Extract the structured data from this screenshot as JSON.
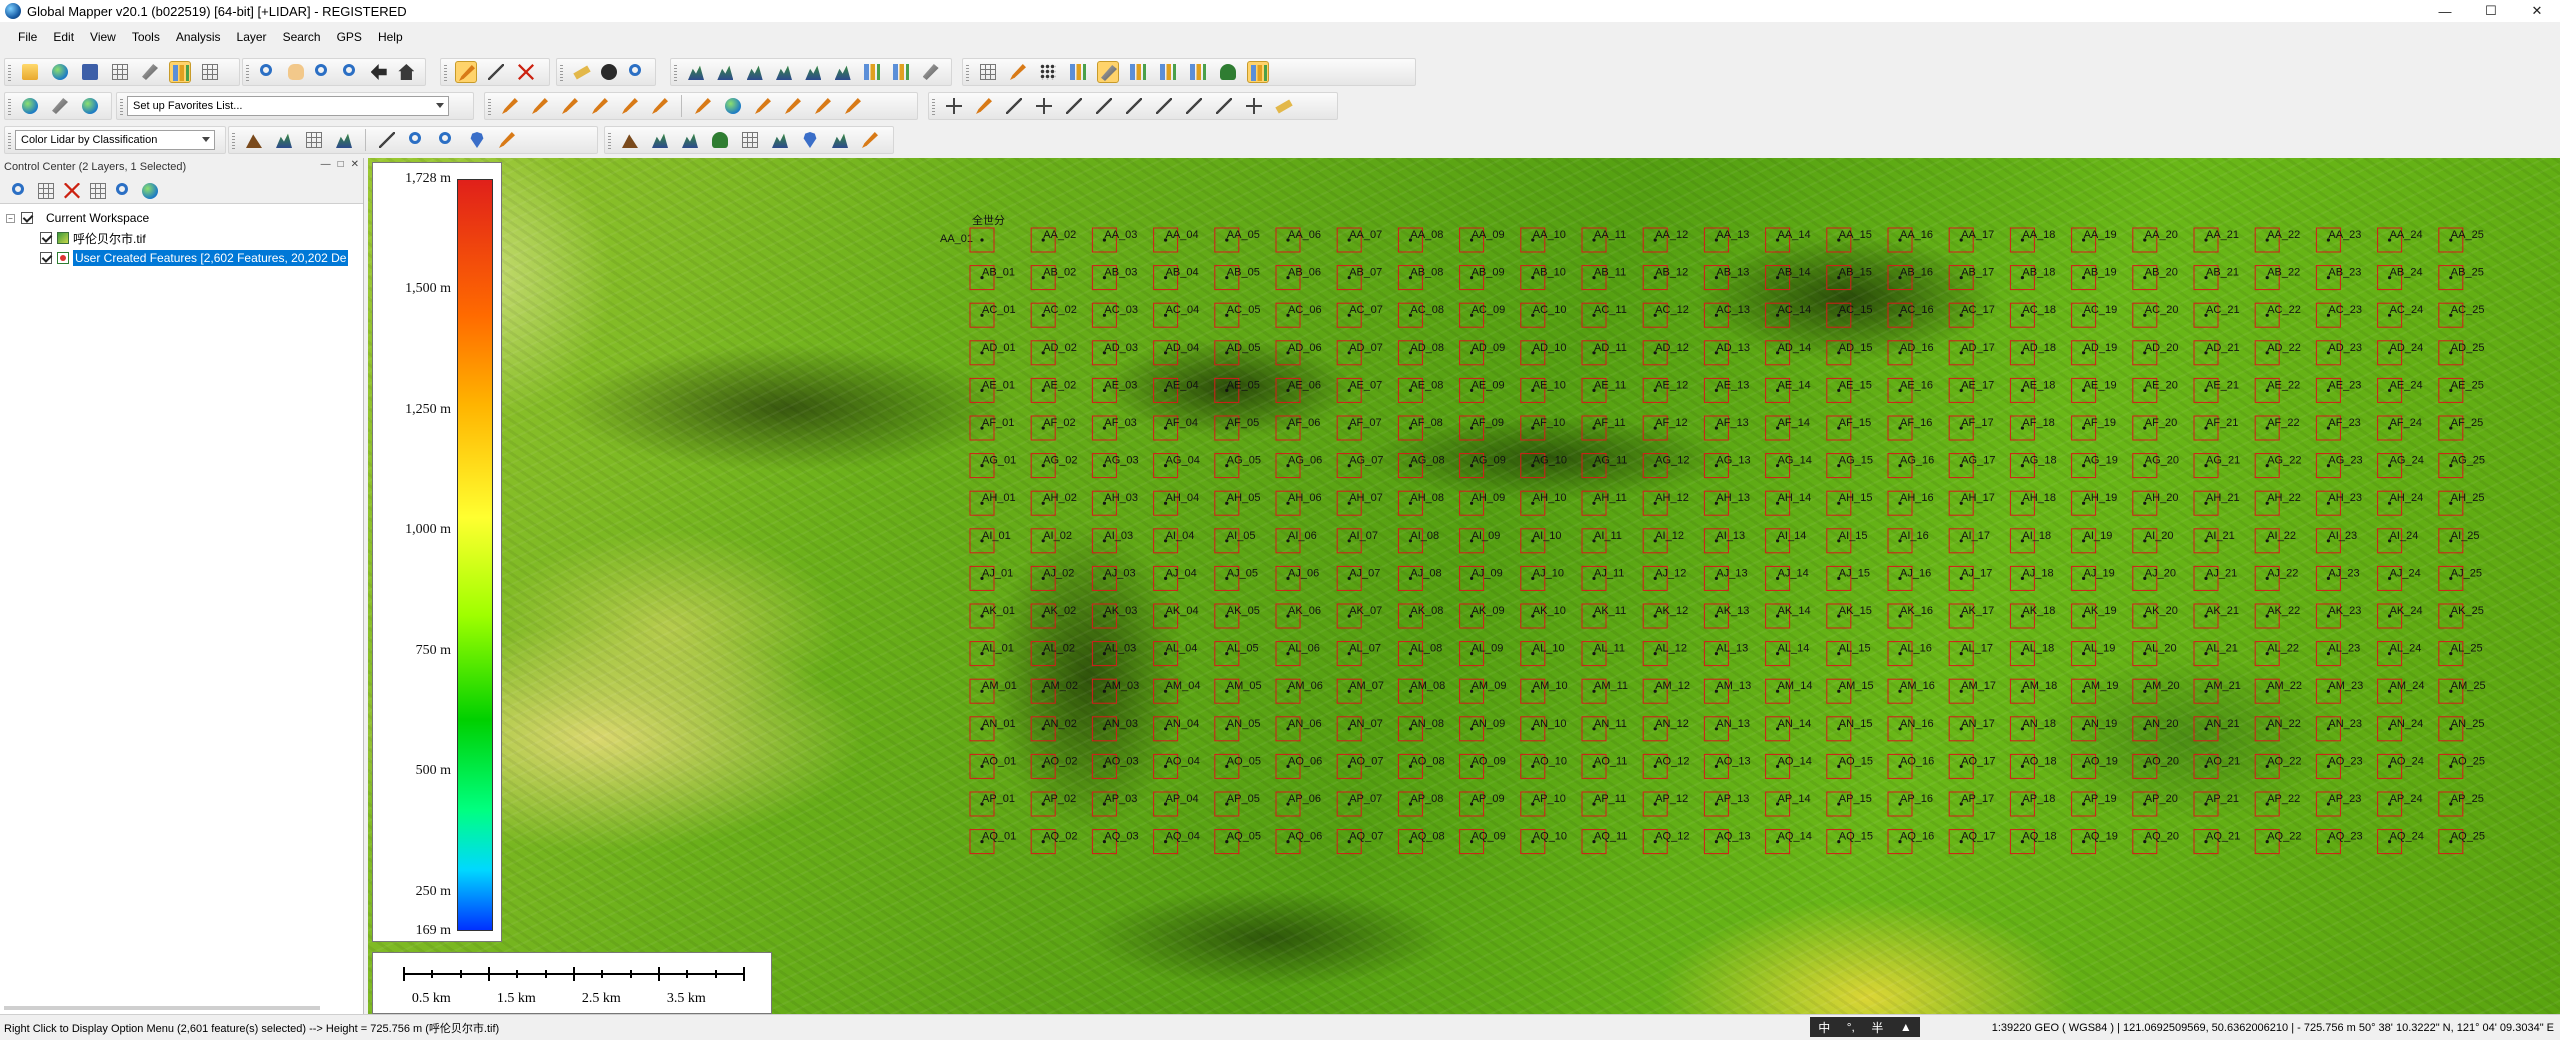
{
  "window": {
    "title": "Global Mapper v20.1 (b022519) [64-bit] [+LIDAR] - REGISTERED",
    "minimize": "—",
    "maximize": "☐",
    "close": "✕"
  },
  "menu": [
    "File",
    "Edit",
    "View",
    "Tools",
    "Analysis",
    "Layer",
    "Search",
    "GPS",
    "Help"
  ],
  "toolbar": {
    "favorites_combo": "Set up Favorites List...",
    "lidar_combo": "Color Lidar by Classification"
  },
  "control_center": {
    "title": "Control Center (2 Layers, 1 Selected)",
    "workspace": "Current Workspace",
    "layers": [
      {
        "name": "呼伦贝尔市.tif",
        "type": "raster",
        "selected": false
      },
      {
        "name": "User Created Features [2,602 Features, 20,202 De",
        "type": "vector",
        "selected": true
      }
    ]
  },
  "legend": {
    "ticks": [
      "1,728 m",
      "1,500 m",
      "1,250 m",
      "1,000 m",
      "750 m",
      "500 m",
      "250 m",
      "169 m"
    ],
    "tick_values": [
      1728,
      1500,
      1250,
      1000,
      750,
      500,
      250,
      169
    ],
    "min": 169,
    "max": 1728
  },
  "scale_bar": {
    "labels": [
      "0.5 km",
      "1.5 km",
      "2.5 km",
      "3.5 km"
    ]
  },
  "grid": {
    "rows": [
      "AA",
      "AB",
      "AC",
      "AD",
      "AE",
      "AF",
      "AG",
      "AH",
      "AI",
      "AJ",
      "AK",
      "AL",
      "AM",
      "AN",
      "AO",
      "AP",
      "AQ"
    ],
    "cols": 25,
    "first_label": "AA_01",
    "header_partial": "全世分"
  },
  "status": {
    "left": "Right Click to Display Option Menu (2,601 feature(s) selected) --> Height = 725.756 m (呼伦贝尔市.tif)",
    "ime": [
      "中",
      "°,",
      "半"
    ],
    "right": "1:39220  GEO ( WGS84 ) | 121.0692509569, 50.6362006210 | - 725.756 m  50° 38' 10.3222\" N, 121° 04' 09.3034\" E"
  },
  "colors": {
    "grid_line": "#d81a1a",
    "selection": "#0078d7"
  }
}
